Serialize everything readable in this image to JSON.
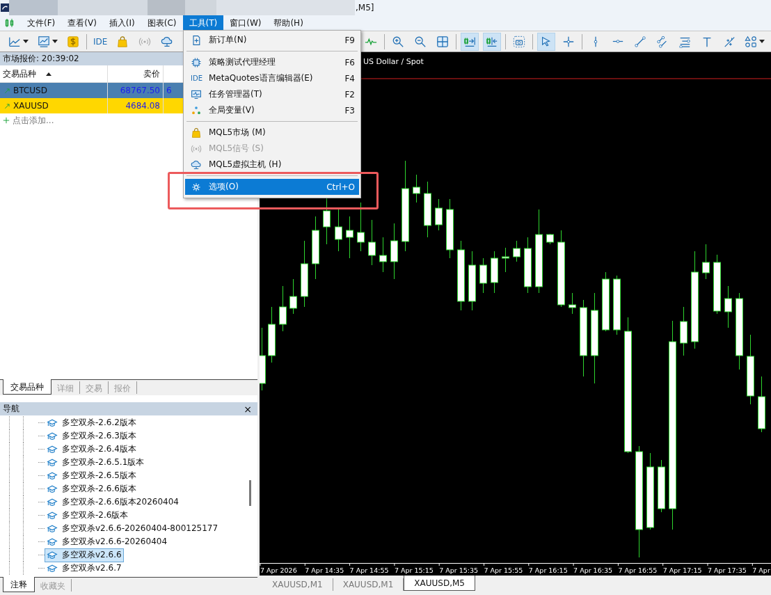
{
  "window": {
    "title": ",M5]"
  },
  "menu_bar": [
    {
      "label": "文件(F)",
      "selected": false
    },
    {
      "label": "查看(V)",
      "selected": false
    },
    {
      "label": "插入(I)",
      "selected": false
    },
    {
      "label": "图表(C)",
      "selected": false
    },
    {
      "label": "工具(T)",
      "selected": true
    },
    {
      "label": "窗口(W)",
      "selected": false
    },
    {
      "label": "帮助(H)",
      "selected": false
    }
  ],
  "toolbar": {
    "ide_label": "IDE",
    "right_buttons": [
      {
        "selected": false
      },
      {
        "selected": false
      },
      {
        "selected": false
      },
      {
        "selected": false
      },
      {
        "selected": true
      },
      {
        "selected": true
      },
      {
        "selected": false
      },
      {
        "selected": true
      },
      {
        "selected": false
      },
      {
        "selected": false
      },
      {
        "selected": false
      },
      {
        "selected": false
      },
      {
        "selected": false
      },
      {
        "selected": false
      },
      {
        "selected": false
      },
      {
        "selected": false
      },
      {
        "selected": false
      }
    ]
  },
  "market_watch": {
    "title": "市场报价: 20:39:02",
    "columns": [
      "交易品种",
      "卖价"
    ],
    "rows": [
      {
        "symbol": "BTCUSD",
        "bid": "68767.50",
        "column_3": "6",
        "color": "#4a7fb0"
      },
      {
        "symbol": "XAUUSD",
        "bid": "4684.08",
        "color": "#ffd700"
      }
    ],
    "add_row": "点击添加...",
    "tabs": [
      {
        "label": "交易品种",
        "selected": true
      },
      {
        "label": "详细",
        "selected": false
      },
      {
        "label": "交易",
        "selected": false
      },
      {
        "label": "报价",
        "selected": false
      }
    ]
  },
  "navigator": {
    "title": "导航",
    "close": "×",
    "items": [
      {
        "label": "多空双杀-2.6.2版本",
        "selected": false
      },
      {
        "label": "多空双杀-2.6.3版本",
        "selected": false
      },
      {
        "label": "多空双杀-2.6.4版本",
        "selected": false
      },
      {
        "label": "多空双杀-2.6.5.1版本",
        "selected": false
      },
      {
        "label": "多空双杀-2.6.5版本",
        "selected": false
      },
      {
        "label": "多空双杀-2.6.6版本",
        "selected": false
      },
      {
        "label": "多空双杀-2.6.6版本20260404",
        "selected": false
      },
      {
        "label": "多空双杀-2.6版本",
        "selected": false
      },
      {
        "label": "多空双杀v2.6.6-20260404-800125177",
        "selected": false
      },
      {
        "label": "多空双杀v2.6.6-20260404",
        "selected": false
      },
      {
        "label": "多空双杀v2.6.6",
        "selected": true
      },
      {
        "label": "多空双杀v2.6.7",
        "selected": false
      }
    ],
    "tabs": [
      {
        "label": "注释",
        "selected": true
      },
      {
        "label": "收藏夹",
        "selected": false
      }
    ]
  },
  "chart": {
    "label": "US Dollar / Spot",
    "time_labels": [
      "7 Apr 2026",
      "7 Apr 14:35",
      "7 Apr 14:55",
      "7 Apr 15:15",
      "7 Apr 15:35",
      "7 Apr 15:55",
      "7 Apr 16:15",
      "7 Apr 16:35",
      "7 Apr 16:55",
      "7 Apr 17:15",
      "7 Apr 17:35",
      "7 Apr"
    ],
    "tabs": [
      {
        "label": "XAUUSD,M1",
        "selected": false
      },
      {
        "label": "XAUUSD,M1",
        "selected": false
      },
      {
        "label": "XAUUSD,M5",
        "selected": true
      }
    ]
  },
  "tools_menu": [
    {
      "kind": "item",
      "label": "新订单(N)",
      "shortcut": "F9",
      "disabled": false,
      "selected": false
    },
    {
      "kind": "separator"
    },
    {
      "kind": "item",
      "label": "策略测试代理经理",
      "shortcut": "F6",
      "disabled": false,
      "selected": false
    },
    {
      "kind": "item",
      "label": "MetaQuotes语言编辑器(E)",
      "shortcut": "F4",
      "icon_text": "IDE",
      "disabled": false,
      "selected": false
    },
    {
      "kind": "item",
      "label": "任务管理器(T)",
      "shortcut": "F2",
      "disabled": false,
      "selected": false
    },
    {
      "kind": "item",
      "label": "全局变量(V)",
      "shortcut": "F3",
      "disabled": false,
      "selected": false
    },
    {
      "kind": "separator"
    },
    {
      "kind": "item",
      "label": "MQL5市场 (M)",
      "disabled": false,
      "selected": false
    },
    {
      "kind": "item",
      "label": "MQL5信号 (S)",
      "disabled": true,
      "selected": false
    },
    {
      "kind": "item",
      "label": "MQL5虚拟主机 (H)",
      "disabled": false,
      "selected": false
    },
    {
      "kind": "separator"
    },
    {
      "kind": "item",
      "label": "选项(O)",
      "shortcut": "Ctrl+O",
      "disabled": false,
      "selected": true
    }
  ]
}
